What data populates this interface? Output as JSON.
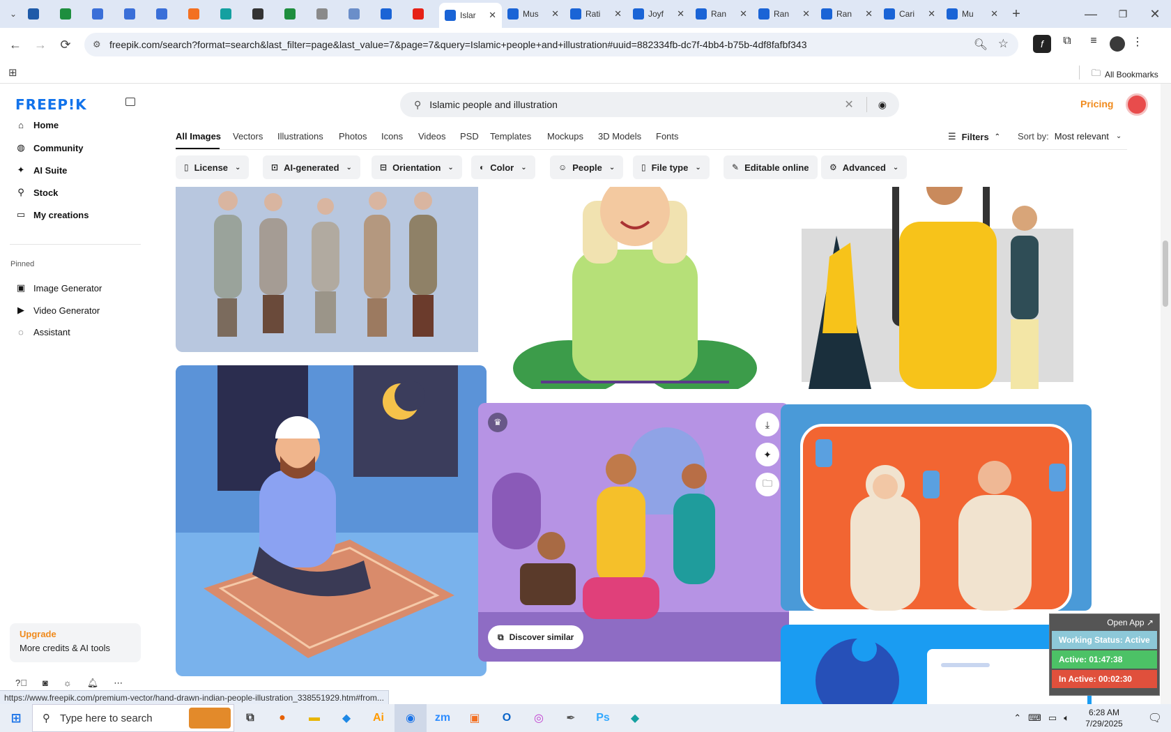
{
  "browser": {
    "tabs": [
      {
        "icon": "wordpress-icon",
        "color": "#1e5aa8"
      },
      {
        "icon": "sheets-icon",
        "color": "#1e8e3e"
      },
      {
        "icon": "docs-icon",
        "color": "#3a6fd8"
      },
      {
        "icon": "docs-icon",
        "color": "#3a6fd8"
      },
      {
        "icon": "docs-icon",
        "color": "#3a6fd8"
      },
      {
        "icon": "xampp-icon",
        "color": "#f37021"
      },
      {
        "icon": "app-icon",
        "color": "#14a0a0"
      },
      {
        "icon": "chatgpt-icon",
        "color": "#333333"
      },
      {
        "icon": "sheets-icon",
        "color": "#1e8e3e"
      },
      {
        "icon": "globe-icon",
        "color": "#8a8a8a"
      },
      {
        "icon": "app-icon",
        "color": "#6b8ec9"
      },
      {
        "icon": "freepik-icon",
        "color": "#1a64d6"
      },
      {
        "icon": "youtube-icon",
        "color": "#e62117"
      }
    ],
    "named_tabs": [
      {
        "title": "Islar",
        "active": true
      },
      {
        "title": "Mus",
        "active": false
      },
      {
        "title": "Rati",
        "active": false
      },
      {
        "title": "Joyf",
        "active": false
      },
      {
        "title": "Ran",
        "active": false
      },
      {
        "title": "Ran",
        "active": false
      },
      {
        "title": "Ran",
        "active": false
      },
      {
        "title": "Cari",
        "active": false
      },
      {
        "title": "Mu",
        "active": false
      }
    ],
    "url": "freepik.com/search?format=search&last_filter=page&last_value=7&page=7&query=Islamic+people+and+illustration#uuid=882334fb-dc7f-4bb4-b75b-4df8fafbf343",
    "all_bookmarks": "All Bookmarks",
    "status_url": "https://www.freepik.com/premium-vector/hand-drawn-indian-people-illustration_338551929.htm#from..."
  },
  "sidebar": {
    "logo": "FREEP!K",
    "nav": [
      {
        "label": "Home",
        "icon": "home-icon"
      },
      {
        "label": "Community",
        "icon": "globe-icon"
      },
      {
        "label": "AI Suite",
        "icon": "sparkle-icon"
      },
      {
        "label": "Stock",
        "icon": "search-icon"
      },
      {
        "label": "My creations",
        "icon": "folder-icon"
      }
    ],
    "pinned_label": "Pinned",
    "pinned": [
      {
        "label": "Image Generator",
        "icon": "image-icon"
      },
      {
        "label": "Video Generator",
        "icon": "video-icon"
      },
      {
        "label": "Assistant",
        "icon": "assistant-icon"
      }
    ],
    "upgrade": {
      "title": "Upgrade",
      "subtitle": "More credits & AI tools"
    }
  },
  "header": {
    "search_value": "Islamic people and illustration",
    "pricing": "Pricing"
  },
  "categories": [
    "All Images",
    "Vectors",
    "Illustrations",
    "Photos",
    "Icons",
    "Videos",
    "PSD",
    "Templates",
    "Mockups",
    "3D Models",
    "Fonts"
  ],
  "active_category": "All Images",
  "filters_label": "Filters",
  "sort": {
    "label": "Sort by:",
    "value": "Most relevant"
  },
  "filter_buttons": [
    {
      "label": "License",
      "icon": "license-icon",
      "dropdown": true
    },
    {
      "label": "AI-generated",
      "icon": "ai-icon",
      "dropdown": true
    },
    {
      "label": "Orientation",
      "icon": "orientation-icon",
      "dropdown": true
    },
    {
      "label": "Color",
      "icon": "color-icon",
      "dropdown": true
    },
    {
      "label": "People",
      "icon": "people-icon",
      "dropdown": true
    },
    {
      "label": "File type",
      "icon": "file-icon",
      "dropdown": true
    },
    {
      "label": "Editable online",
      "icon": "edit-icon",
      "dropdown": false
    },
    {
      "label": "Advanced",
      "icon": "gear-icon",
      "dropdown": true
    }
  ],
  "results": {
    "discover_similar": "Discover similar"
  },
  "overlay": {
    "open_app": "Open App ↗",
    "working": "Working Status: Active",
    "active": "Active: 01:47:38",
    "inactive": "In Active: 00:02:30"
  },
  "taskbar": {
    "search_placeholder": "Type here to search",
    "time": "6:28 AM",
    "date": "7/29/2025"
  }
}
